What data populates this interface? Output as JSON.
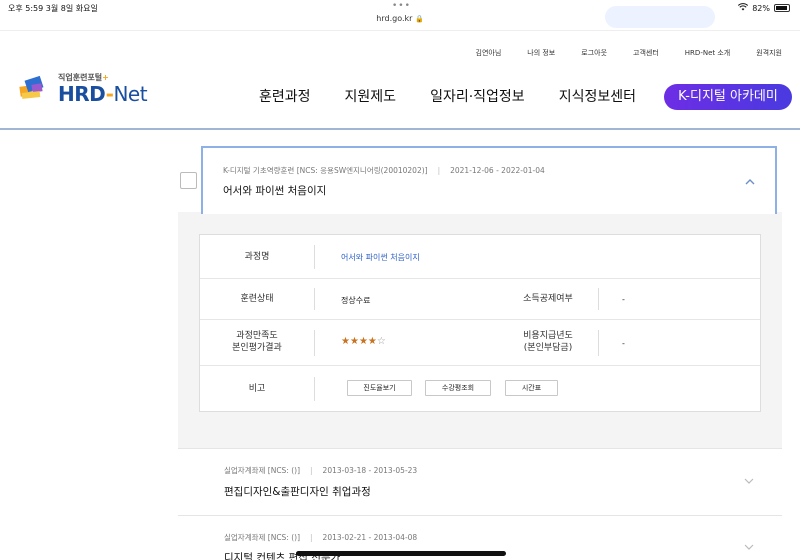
{
  "status_bar": {
    "time_date": "오후 5:59   3월 8일 화요일",
    "url": "hrd.go.kr",
    "battery": "82%"
  },
  "util_nav": [
    "김연아님",
    "나의 정보",
    "로그아웃",
    "고객센터",
    "HRD-Net 소개",
    "원격지원"
  ],
  "logo": {
    "subtitle": "직업훈련포털",
    "name_hrd": "HRD",
    "name_dash": "-",
    "name_net": "Net"
  },
  "main_nav": [
    "훈련과정",
    "지원제도",
    "일자리·직업정보",
    "지식정보센터"
  ],
  "k_digital_button": "K-디지털 아카데미",
  "open_course": {
    "meta": "K-디지털 기초역량훈련 [NCS: 응용SW엔지니어링(20010202)]",
    "period": "2021-12-06 - 2022-01-04",
    "title": "어서와 파이썬 처음이지"
  },
  "detail": {
    "course_name_label": "과정명",
    "course_name_value": "어서와 파이썬 처음이지",
    "status_label": "훈련상태",
    "status_value": "정상수료",
    "tax_label": "소득공제여부",
    "tax_value": "-",
    "satisfaction_label_1": "과정만족도",
    "satisfaction_label_2": "본인평가결과",
    "rating": 4,
    "rating_max": 5,
    "pay_label_1": "비용지급년도",
    "pay_label_2": "(본인부담금)",
    "pay_value": "-",
    "note_label": "비고",
    "buttons": [
      "진도율보기",
      "수강평조회",
      "시간표"
    ]
  },
  "courses": [
    {
      "meta": "실업자계좌제 [NCS: ()]",
      "period": "2013-03-18 - 2013-05-23",
      "title": "편집디자인&출판디자인 취업과정"
    },
    {
      "meta": "실업자계좌제 [NCS: ()]",
      "period": "2013-02-21 - 2013-04-08",
      "title": "디지털 컨텐츠 편집 전문가"
    }
  ],
  "colors": {
    "brand_blue": "#1a4fa0",
    "accent_orange": "#f5a623",
    "k_button_start": "#6d2de4",
    "k_button_end": "#4a3ae0",
    "link_blue": "#2b5fc4",
    "star": "#c8731e"
  }
}
